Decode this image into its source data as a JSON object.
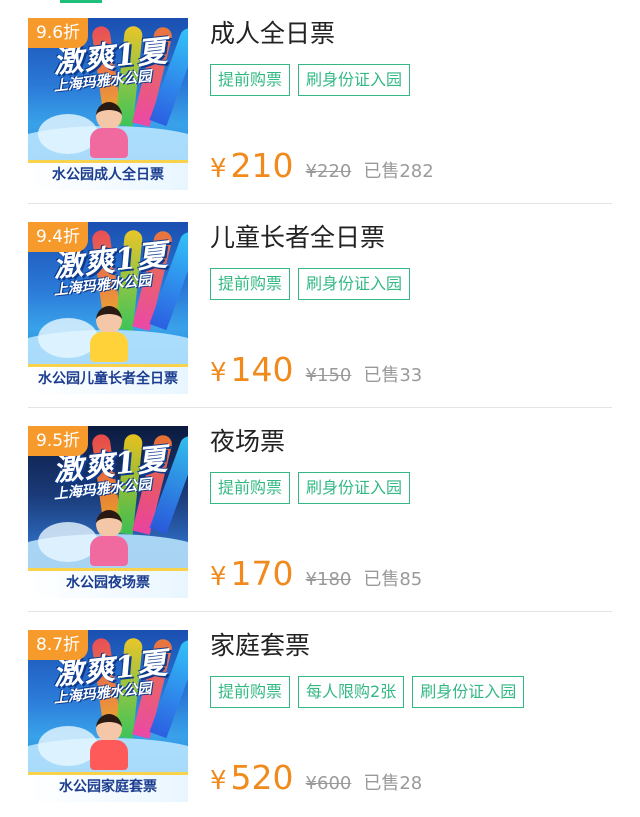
{
  "theme": {
    "discount_badge_color": "#f79a2c",
    "tag_color": "#34b985",
    "price_color": "#f08a1c",
    "muted_color": "#9a9a9a",
    "accent_bar_color": "#1fbf7a"
  },
  "tickets": [
    {
      "discount": "9.6折",
      "title": "成人全日票",
      "image": {
        "logo": "激爽1夏",
        "subtitle": "上海玛雅水公园",
        "caption": "水公园成人全日票"
      },
      "tags": [
        "提前购票",
        "刷身份证入园"
      ],
      "currency": "¥",
      "price": "210",
      "original_price": "¥220",
      "sold_label": "已售",
      "sold_count": "282"
    },
    {
      "discount": "9.4折",
      "title": "儿童长者全日票",
      "image": {
        "logo": "激爽1夏",
        "subtitle": "上海玛雅水公园",
        "caption": "水公园儿童长者全日票"
      },
      "tags": [
        "提前购票",
        "刷身份证入园"
      ],
      "currency": "¥",
      "price": "140",
      "original_price": "¥150",
      "sold_label": "已售",
      "sold_count": "33"
    },
    {
      "discount": "9.5折",
      "title": "夜场票",
      "image": {
        "logo": "激爽1夏",
        "subtitle": "上海玛雅水公园",
        "caption": "水公园夜场票"
      },
      "tags": [
        "提前购票",
        "刷身份证入园"
      ],
      "currency": "¥",
      "price": "170",
      "original_price": "¥180",
      "sold_label": "已售",
      "sold_count": "85"
    },
    {
      "discount": "8.7折",
      "title": "家庭套票",
      "image": {
        "logo": "激爽1夏",
        "subtitle": "上海玛雅水公园",
        "caption": "水公园家庭套票"
      },
      "tags": [
        "提前购票",
        "每人限购2张",
        "刷身份证入园"
      ],
      "currency": "¥",
      "price": "520",
      "original_price": "¥600",
      "sold_label": "已售",
      "sold_count": "28"
    }
  ]
}
